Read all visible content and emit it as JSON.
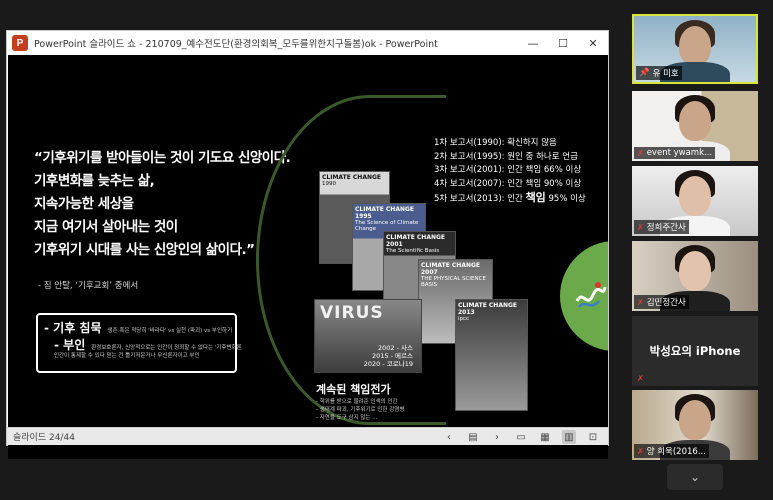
{
  "window": {
    "app_label": "P",
    "title": "PowerPoint 슬라이드 쇼  -  210709_예수전도단(환경의회복_모두를위한지구돌봄)ok - PowerPoint",
    "minimize": "—",
    "maximize": "☐",
    "close": "✕"
  },
  "slide": {
    "quote_lines": [
      "“기후위기를 받아들이는 것이 기도요 신앙이다.",
      "기후변화를 늦추는 삶,",
      "지속가능한 세상을",
      "지금 여기서 살아내는  것이",
      "기후위기 시대를 사는 신앙인의 삶이다.”"
    ],
    "quote_source": "- 짐 안탈, ‘기후교회’ 중에서",
    "terms": {
      "head1": "- 기후 침묵",
      "note1": "생존 혹은 적당히 '바라다' vs 실천 (파괴) vs 부인하기",
      "head2": "- 부인",
      "note2a": "환경보호론자, 신앙적으로는 인간이 정죄할 수 없다는 '기후변화론",
      "note2b": "인간이 통제할 수 있다 믿는 건 틀기저운거나 무신론자이고 부인"
    },
    "reports": [
      "1차 보고서(1990): 확신하지 않음",
      "2차 보고서(1995): 원인 중 하나로 언급",
      "3차 보고서(2001): 인간 책임 66% 이상",
      "4차 보고서(2007): 인간 책임 90% 이상"
    ],
    "report5_prefix": "5차 보고서(2013): 인간 ",
    "report5_big": "책임",
    "report5_suffix": " 95% 이상",
    "covers": [
      {
        "title": "CLIMATE CHANGE",
        "sub": "1990"
      },
      {
        "title": "CLIMATE CHANGE 1995",
        "sub": "The Science of Climate Change"
      },
      {
        "title": "CLIMATE CHANGE 2001",
        "sub": "The Scientific Basis"
      },
      {
        "title": "CLIMATE CHANGE 2007",
        "sub": "THE PHYSICAL SCIENCE BASIS"
      },
      {
        "title": "CLIMATE CHANGE 2013",
        "sub": "ipcc"
      }
    ],
    "virus": {
      "title": "VIRUS",
      "line1": "2002 - 사스",
      "line2": "2015 - 메르스",
      "line3": "2020 - 코로나19"
    },
    "responsibility_title": "계속된 책임전가",
    "responsibility_items": [
      "- 학위를 받으로 물려준 인색의 인간",
      "- 생태계 파괴, 기후위기로 인한 감염병",
      "- 자연을 도구 삼지 않는 ..."
    ]
  },
  "status": {
    "slide_counter": "슬라이드 24/44",
    "prev": "‹",
    "next": "›",
    "notes": "▤",
    "normal_view": "▭",
    "sorter_view": "▦",
    "reading_view": "▥",
    "slideshow_view": "⊡"
  },
  "participants": [
    {
      "name": "유 미호",
      "muted": false,
      "active": true
    },
    {
      "name": "event ywamk...",
      "muted": true,
      "active": false
    },
    {
      "name": "정희주간사",
      "muted": true,
      "active": false
    },
    {
      "name": "김민정간사",
      "muted": true,
      "active": false
    },
    {
      "name": "박성요의 iPhone",
      "muted": true,
      "active": false
    },
    {
      "name": "양 희욱(2016...",
      "muted": true,
      "active": false
    }
  ],
  "icons": {
    "mic_muted": "✗",
    "pin": "📌",
    "scroll_down": "⌄"
  }
}
